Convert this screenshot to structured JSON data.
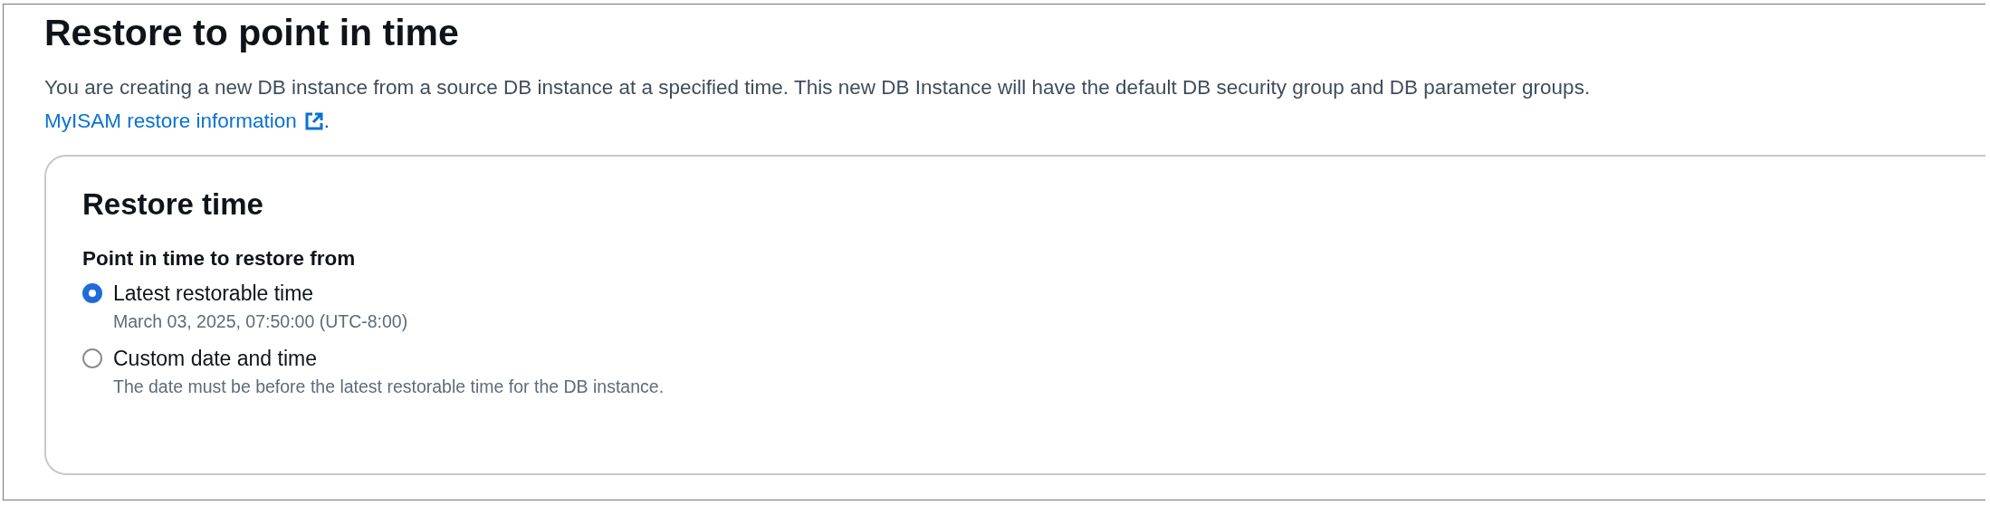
{
  "title": "Restore to point in time",
  "description": "You are creating a new DB instance from a source DB instance at a specified time. This new DB Instance will have the default DB security group and DB parameter groups.",
  "link": {
    "label": "MyISAM restore information",
    "suffix": "."
  },
  "section": {
    "title": "Restore time",
    "field_label": "Point in time to restore from",
    "options": [
      {
        "label": "Latest restorable time",
        "description": "March 03, 2025, 07:50:00 (UTC-8:00)",
        "selected": true
      },
      {
        "label": "Custom date and time",
        "description": "The date must be before the latest restorable time for the DB instance.",
        "selected": false
      }
    ]
  }
}
